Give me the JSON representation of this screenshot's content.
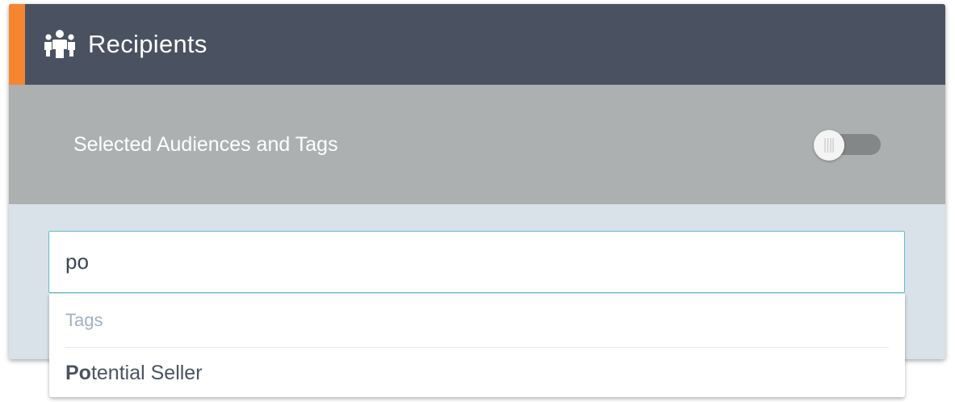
{
  "header": {
    "title": "Recipients",
    "icon": "group-icon",
    "accent_color": "#f5862f",
    "background_color": "#4a5262"
  },
  "toggle_row": {
    "label": "Selected Audiences and Tags",
    "toggle_on": false
  },
  "search": {
    "value": "po",
    "border_color": "#5fbfcb"
  },
  "dropdown": {
    "section_label": "Tags",
    "options": [
      {
        "match": "Po",
        "rest": "tential Seller"
      }
    ]
  }
}
